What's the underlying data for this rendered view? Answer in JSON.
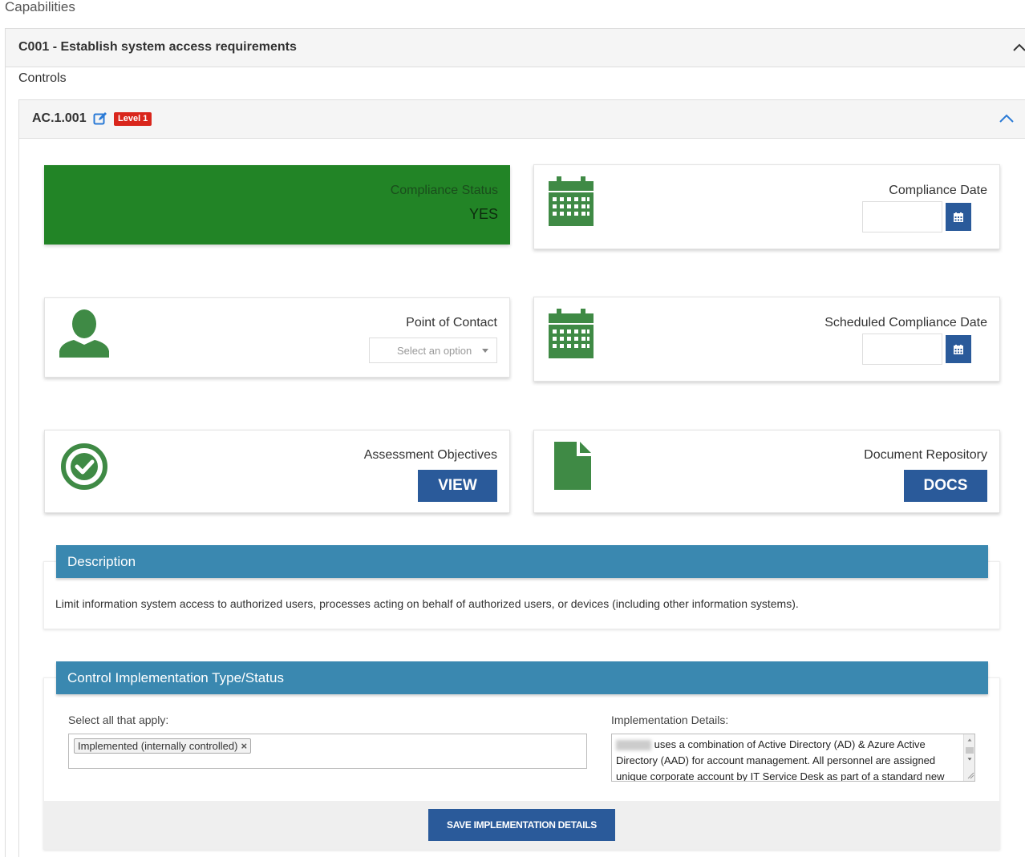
{
  "page": {
    "heading": "Capabilities"
  },
  "capability": {
    "title": "C001 - Establish system access requirements"
  },
  "controls": {
    "label": "Controls",
    "control": {
      "id": "AC.1.001",
      "level": "Level 1"
    }
  },
  "cards": {
    "compliance_status": {
      "label": "Compliance Status",
      "value": "YES",
      "color": "#228426"
    },
    "compliance_date": {
      "label": "Compliance Date",
      "value": ""
    },
    "point_of_contact": {
      "label": "Point of Contact",
      "placeholder": "Select an option"
    },
    "scheduled_compliance_date": {
      "label": "Scheduled Compliance Date",
      "value": ""
    },
    "assessment_objectives": {
      "label": "Assessment Objectives",
      "button": "VIEW"
    },
    "document_repository": {
      "label": "Document Repository",
      "button": "DOCS"
    }
  },
  "description": {
    "title": "Description",
    "text": "Limit information system access to authorized users, processes acting on behalf of authorized users, or devices (including other information systems)."
  },
  "implementation": {
    "title": "Control Implementation Type/Status",
    "select_label": "Select all that apply:",
    "selected": [
      "Implemented (internally controlled)"
    ],
    "details_label": "Implementation Details:",
    "details_text": " uses a combination of Active Directory (AD) & Azure Active Directory (AAD) for account management.  All personnel are assigned unique corporate account by IT Service Desk as part of a standard new employee",
    "save_button": "SAVE IMPLEMENTATION DETAILS"
  },
  "icons": {
    "calendar": "calendar-icon",
    "user": "user-icon",
    "check": "check-circle-icon",
    "document": "document-icon",
    "edit": "edit-icon"
  },
  "colors": {
    "accent_blue": "#2a5a9a",
    "section_blue": "#3a88b0",
    "icon_green": "#3f8a45",
    "badge_red": "#d9261c"
  }
}
